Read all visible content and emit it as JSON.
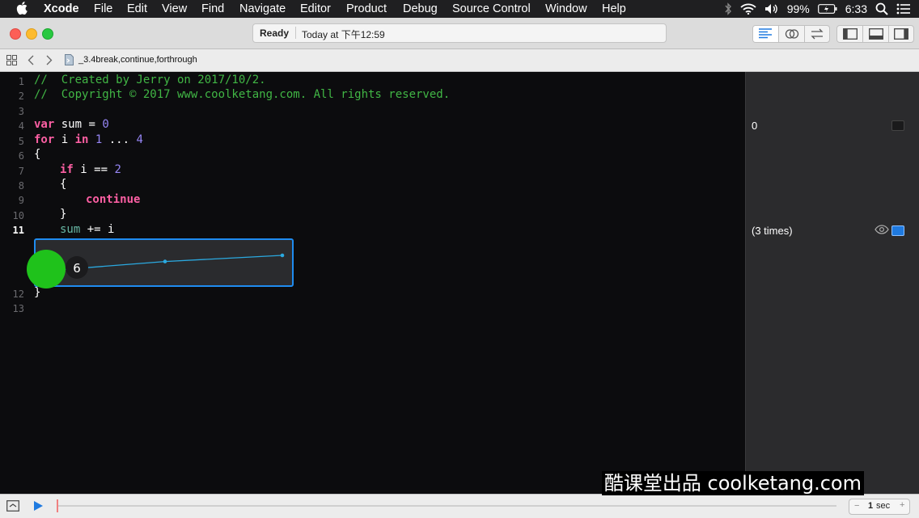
{
  "menubar": {
    "app_name": "Xcode",
    "items": [
      "File",
      "Edit",
      "View",
      "Find",
      "Navigate",
      "Editor",
      "Product",
      "Debug",
      "Source Control",
      "Window",
      "Help"
    ],
    "battery": "99%",
    "clock": "6:33"
  },
  "titlebar": {
    "status": "Ready",
    "timestamp": "Today at 下午12:59"
  },
  "jumpbar": {
    "file": "_3.4break,continue,forthrough"
  },
  "editor": {
    "line_numbers": [
      "1",
      "2",
      "3",
      "4",
      "5",
      "6",
      "7",
      "8",
      "9",
      "10",
      "11",
      "12",
      "13"
    ],
    "current_line": "11",
    "lines": {
      "l1": "//  Created by Jerry on 2017/10/2.",
      "l2": "//  Copyright © 2017 www.coolketang.com. All rights reserved.",
      "l4_kw": "var",
      "l4_rest": " sum = ",
      "l4_num": "0",
      "l5_kw": "for",
      "l5_var": " i ",
      "l5_in": "in",
      "l5_a": "1",
      "l5_op": " ... ",
      "l5_b": "4",
      "l6": "{",
      "l7_kw": "if",
      "l7_rest": " i == ",
      "l7_num": "2",
      "l8": "{",
      "l9_kw": "continue",
      "l10": "}",
      "l11_var": "sum",
      "l11_rest": " += i",
      "l12": "}"
    }
  },
  "inline_graph": {
    "value_label": "6",
    "points": [
      0,
      1,
      4,
      6
    ]
  },
  "results": {
    "line4": "0",
    "line11": "(3 times)"
  },
  "debugbar": {
    "time_value": "1",
    "time_unit": "sec"
  },
  "watermark": "酷课堂出品 coolketang.com",
  "colors": {
    "comment": "#41b645",
    "keyword": "#fc5fa3",
    "number": "#9686f5",
    "graph_line": "#2aa9e0",
    "graph_border": "#1f8cf0",
    "highlight_circle": "#1fc21b"
  }
}
